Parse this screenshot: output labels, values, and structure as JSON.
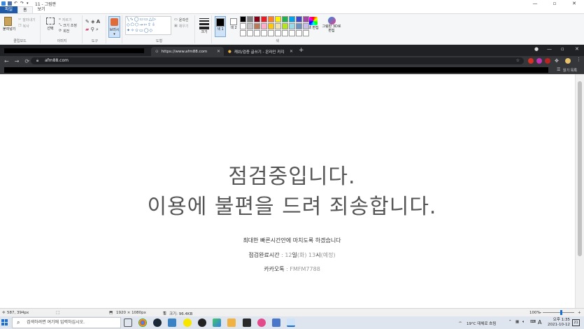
{
  "paint": {
    "title": "11 - 그림판",
    "tabs": [
      "파일",
      "홈",
      "보기"
    ],
    "groups": {
      "clipboard": {
        "label": "클립보드",
        "paste": "붙여넣기",
        "cut": "잘라내기",
        "copy": "복사"
      },
      "image": {
        "label": "이미지",
        "select": "선택",
        "crop": "자르기",
        "resize": "크기 조정",
        "rotate": "회전"
      },
      "tools": {
        "label": "도구"
      },
      "brushes": {
        "label": "브러시"
      },
      "shapes": {
        "label": "도형",
        "outline": "윤곽선",
        "fill": "채우기"
      },
      "size": {
        "label": "크기"
      },
      "colors": {
        "label": "색",
        "color1": "색 1",
        "color2": "색 2",
        "edit": "색 편집",
        "paint3d": "그림판 3D로 편집"
      }
    },
    "palette": [
      "#000000",
      "#7f7f7f",
      "#880015",
      "#ed1c24",
      "#ff7f27",
      "#fff200",
      "#22b14c",
      "#00a2e8",
      "#3f48cc",
      "#a349a4",
      "#ffffff",
      "#c3c3c3",
      "#b97a57",
      "#ffaec9",
      "#ffc90e",
      "#efe4b0",
      "#b5e61d",
      "#99d9ea",
      "#7092be",
      "#c8bfe7",
      "#ffffff",
      "#ffffff",
      "#ffffff",
      "#ffffff",
      "#ffffff",
      "#ffffff",
      "#ffffff",
      "#ffffff",
      "#ffffff",
      "#ffffff"
    ],
    "status": {
      "cursor": "587, 394px",
      "dimensions": "1920 × 1080px",
      "size": "크기: 96.4KB",
      "zoom": "100%"
    }
  },
  "chrome": {
    "tabs": [
      {
        "title": "https://www.afm88.com"
      },
      {
        "title": "캐쉬/검증 글쓰기 - 온라인 카지"
      }
    ],
    "url": "afm88.com",
    "bookmark_right": "읽기 목록"
  },
  "page": {
    "heading1": "점검중입니다.",
    "heading2": "이용에 불편을 드려 죄송합니다.",
    "notice": "최대한 빠른시간안에 마치도록 하겠습니다",
    "complete_label": "점검완료시간",
    "complete_colon": " : ",
    "complete_d1": "12",
    "complete_u1": "일",
    "complete_d2": "(화)",
    "complete_d3": " 13",
    "complete_u2": "시",
    "complete_d4": "(예정)",
    "kakao_label": "카카오톡",
    "kakao_value": " : FMFM7788"
  },
  "taskbar": {
    "search_placeholder": "검색하려면 여기에 입력하십시오.",
    "weather": "19°C 대체로 흐림",
    "lang": "A",
    "time": "오후 1:35",
    "date": "2021-10-12",
    "notify": "21"
  }
}
